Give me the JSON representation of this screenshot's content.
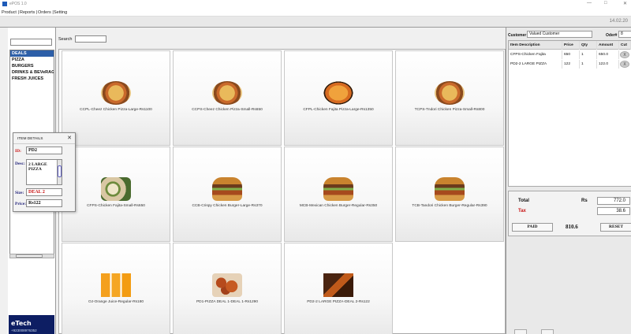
{
  "window": {
    "title": "ePOS 1.0",
    "controls": [
      "—",
      "□",
      "✕"
    ]
  },
  "menu": [
    {
      "label": "Product |"
    },
    {
      "label": "Reports |"
    },
    {
      "label": "Orders |"
    },
    {
      "label": "Setting"
    }
  ],
  "date": "14.02.20",
  "sidebar": {
    "search_value": "",
    "categories": [
      {
        "label": "DEALS",
        "selected": true
      },
      {
        "label": "PIZZA"
      },
      {
        "label": "BURGERS"
      },
      {
        "label": "DRINKS & BEVeRAGES"
      },
      {
        "label": "FRESH JUICES"
      }
    ],
    "logo_text": "eTech",
    "logo_phone": "+923008976352"
  },
  "center": {
    "search_label": "Search",
    "search_value": "",
    "products": [
      {
        "label": "CCPL-Cheez Chicken Pizza-Large-Rs1100",
        "icon": "pizza-image"
      },
      {
        "label": "CCPS-Cheez Chicken Pizza-Small-Rs650",
        "icon": "pizza-image"
      },
      {
        "label": "CFPL-Chicken Fajita Pizza-Large-Rs1350",
        "icon": "pizza-image"
      },
      {
        "label": "TCPS-Tndori Chicken Pizza-Small-Rs800",
        "icon": "pizza-image"
      },
      {
        "label": "CFPS-Chicken Fajita-Small-Rs650",
        "icon": "fajita-image"
      },
      {
        "label": "CCB-Crispy Chicken Burger-Large-Rs370",
        "icon": "burger-image"
      },
      {
        "label": "MCB-Mexican Chicken Burger-Regular-Rs350",
        "icon": "burger-image"
      },
      {
        "label": "TCB-Tandori Chicken Burger-Regular-Rs390",
        "icon": "burger-image"
      },
      {
        "label": "OJ-Orange Juice-Regular-Rs180",
        "icon": "juice-image"
      },
      {
        "label": "PD1-PIZZA DEAL 1-DEAL 1-Rs1290",
        "icon": "deal-image"
      },
      {
        "label": "PD2-2 LARGE PIZZA-DEAL 2-Rs122",
        "icon": "deal-image"
      }
    ]
  },
  "item_dialog": {
    "title": "ITEM DETAILS",
    "close": "✕",
    "id_label": "ID:",
    "id_value": "PD2",
    "desc_label": "Desc:",
    "desc_value": "2 LARGE PIZZA",
    "size_label": "Size:",
    "size_value": "DEAL 2",
    "price_label": "Price:",
    "price_value": "Rs122"
  },
  "order": {
    "customer_label": "Customer",
    "customer_value": "Valued Customer",
    "order_label": "Oder#",
    "order_value": "8",
    "columns": [
      "Item Description",
      "Price",
      "Qty",
      "Amount",
      "Cut"
    ],
    "rows": [
      {
        "desc": "CFPS-Chicken Fajita",
        "price": "650",
        "qty": "1",
        "amount": "650.0",
        "cut": "X"
      },
      {
        "desc": "PD2-2 LARGE PIZZA",
        "price": "122",
        "qty": "1",
        "amount": "122.0",
        "cut": "X"
      }
    ],
    "total_label": "Total",
    "currency": "Rs",
    "total_value": "772.0",
    "tax_label": "Tax",
    "tax_value": "38.6",
    "paid_label": "PAID",
    "grand_total": "810.6",
    "reset_label": "RESET"
  },
  "colors": {
    "selected": "#2d5fa8",
    "logo_bg": "#0d1e63",
    "accent_red": "#c81414"
  }
}
